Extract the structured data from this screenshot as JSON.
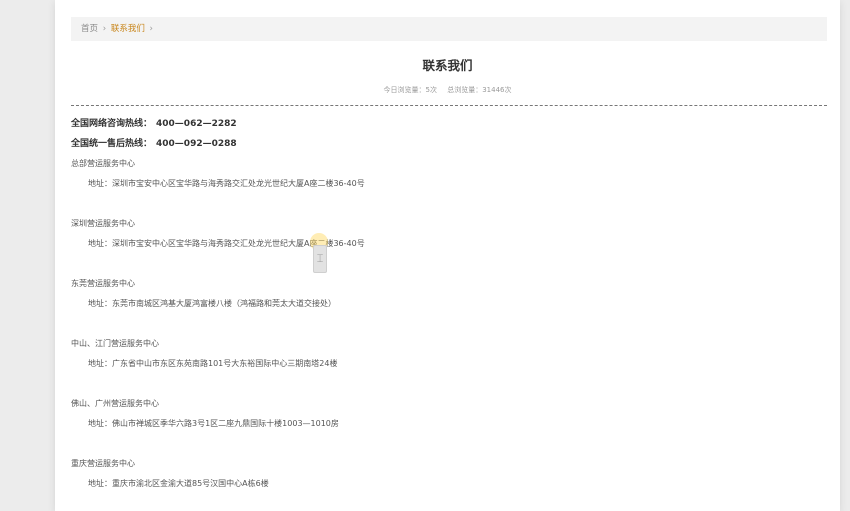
{
  "breadcrumb": {
    "home": "首页",
    "separator": "›",
    "current": "联系我们",
    "trailing": "›"
  },
  "page": {
    "title": "联系我们",
    "stats_today": "今日浏览量：5次",
    "stats_total": "总浏览量：31446次"
  },
  "hotlines": [
    {
      "label": "全国网络咨询热线：",
      "number": "400—062—2282"
    },
    {
      "label": "全国统一售后热线：",
      "number": "400—092—0288"
    }
  ],
  "centers": [
    {
      "name": "总部营运服务中心",
      "address": "地址：深圳市宝安中心区宝华路与海秀路交汇处龙光世纪大厦A座二楼36-40号"
    },
    {
      "name": "深圳营运服务中心",
      "address": "地址：深圳市宝安中心区宝华路与海秀路交汇处龙光世纪大厦A座二楼36-40号"
    },
    {
      "name": "东莞营运服务中心",
      "address": "地址：东莞市南城区鸿基大厦鸿富楼八楼（鸿福路和莞太大道交接处）"
    },
    {
      "name": "中山、江门营运服务中心",
      "address": "地址：广东省中山市东区东苑南路101号大东裕国际中心三期南塔24楼"
    },
    {
      "name": "佛山、广州营运服务中心",
      "address": "地址：佛山市禅城区季华六路3号1区二座九鼎国际十楼1003—1010房"
    },
    {
      "name": "重庆营运服务中心",
      "address": "地址：重庆市渝北区金渝大道85号汉国中心A栋6楼"
    }
  ],
  "colors": {
    "accent": "#c9871d",
    "page_bg": "#ececec",
    "breadcrumb_bg": "#f3f3f3"
  }
}
